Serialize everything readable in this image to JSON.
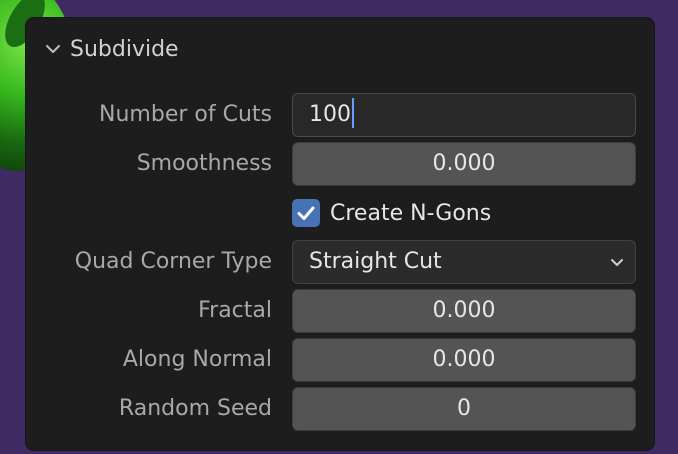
{
  "panel": {
    "title": "Subdivide",
    "expanded": true
  },
  "fields": {
    "number_of_cuts": {
      "label": "Number of Cuts",
      "value": "100",
      "editing": true
    },
    "smoothness": {
      "label": "Smoothness",
      "value": "0.000"
    },
    "create_ngons": {
      "label": "Create N-Gons",
      "checked": true
    },
    "quad_corner_type": {
      "label": "Quad Corner Type",
      "value": "Straight Cut"
    },
    "fractal": {
      "label": "Fractal",
      "value": "0.000"
    },
    "along_normal": {
      "label": "Along Normal",
      "value": "0.000"
    },
    "random_seed": {
      "label": "Random Seed",
      "value": "0"
    }
  },
  "colors": {
    "accent": "#4772b3",
    "caret": "#6b9bff",
    "panel_bg": "#1d1d1d",
    "viewport_bg": "#3f2a64"
  },
  "icons": {
    "panel_toggle": "chevron-down-icon",
    "dropdown": "chevron-down-icon",
    "checkbox": "checkmark-icon"
  }
}
